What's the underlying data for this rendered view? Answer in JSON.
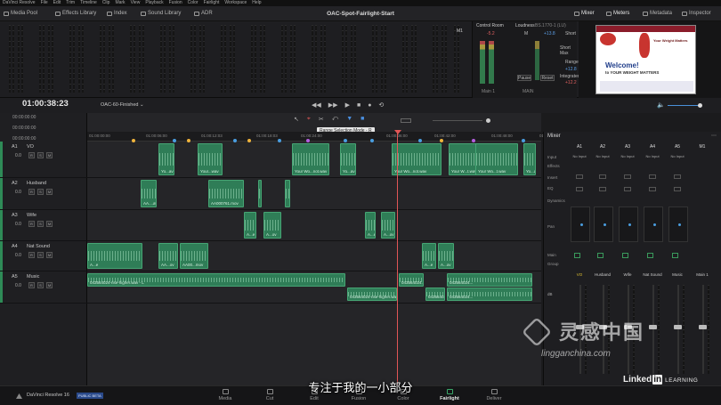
{
  "menubar": [
    "DaVinci Resolve",
    "File",
    "Edit",
    "Trim",
    "Timeline",
    "Clip",
    "Mark",
    "View",
    "Playback",
    "Fusion",
    "Color",
    "Fairlight",
    "Workspace",
    "Help"
  ],
  "toolbar": {
    "media_pool": "Media Pool",
    "effects_library": "Effects Library",
    "index": "Index",
    "sound_library": "Sound Library",
    "adr": "ADR",
    "project_title": "OAC-Spot-Fairlight-Start",
    "mixer": "Mixer",
    "meters": "Meters",
    "metadata": "Metadata",
    "inspector": "Inspector"
  },
  "control_room": {
    "label": "Control Room",
    "m1": "M1",
    "level": "-5.2",
    "loudness_label": "Loudness",
    "standard": "BS.1770-1 (LU)",
    "m_label": "M",
    "m_value": "+13.8",
    "short_label": "Short",
    "short_max_label": "Short Max",
    "range_label": "Range",
    "range_value": "+12.8",
    "integrated_label": "Integrated",
    "integrated_value": "+12.2",
    "pause": "Pause",
    "reset": "Reset",
    "main": "Main 1",
    "dim": "MAIN"
  },
  "video_preview": {
    "headline": "Welcome!",
    "subline": "to YOUR WEIGHT MATTERS",
    "brand": "Your Weight Matters"
  },
  "transport": {
    "timecode": "01:00:38:23",
    "timeline_name": "OAC-60-Finished"
  },
  "timecodes": [
    "00:00:00:00",
    "00:00:00:00",
    "00:00:00:00"
  ],
  "ruler": [
    "01:00:00:00",
    "01:00:06:00",
    "01:00:12:03",
    "01:00:18:03",
    "01:00:24:00",
    "01:00:36:00",
    "01:00:42:00",
    "01:00:48:00",
    "01:00:54:00"
  ],
  "tooltip": "Range Selection Mode - R",
  "tracks": [
    {
      "id": "A1",
      "name": "VO",
      "volume": "0.0",
      "clips": [
        {
          "label": "Yo...av"
        },
        {
          "label": "Your...wav"
        },
        {
          "label": "Your Wo...not.wav"
        },
        {
          "label": "Yo...av"
        },
        {
          "label": "Your Wo...not.wav"
        },
        {
          "label": "Your W...t.wav"
        },
        {
          "label": "Your Wo...t.wav"
        },
        {
          "label": "Yo...av"
        }
      ]
    },
    {
      "id": "A2",
      "name": "Husband",
      "volume": "0.0",
      "clips": [
        {
          "label": "AA....av"
        },
        {
          "label": "AA000761.mov"
        },
        {
          "label": ""
        },
        {
          "label": ""
        }
      ]
    },
    {
      "id": "A3",
      "name": "Wife",
      "volume": "0.0",
      "clips": [
        {
          "label": "A...e"
        },
        {
          "label": "A...ov"
        },
        {
          "label": "A...e"
        },
        {
          "label": "A...ov"
        }
      ]
    },
    {
      "id": "A4",
      "name": "Nat Sound",
      "volume": "0.0",
      "clips": [
        {
          "label": "A...e"
        },
        {
          "label": "AA...ov"
        },
        {
          "label": "AA00...mov"
        },
        {
          "label": "A...e"
        },
        {
          "label": "A...ov"
        }
      ]
    },
    {
      "id": "A5",
      "name": "Music",
      "volume": "0.0",
      "clips": [
        {
          "label": "043564024-rise-higher.wav - L"
        },
        {
          "label": "043564024-rise-higher.wav - R"
        },
        {
          "label": "043564024..."
        },
        {
          "label": "043564024..."
        },
        {
          "label": "043564024..."
        },
        {
          "label": "043564024..."
        }
      ]
    }
  ],
  "mixer": {
    "title": "Mixer",
    "channels": [
      "A1",
      "A2",
      "A3",
      "A4",
      "A5",
      "M1"
    ],
    "input_values": [
      "No Input",
      "No Input",
      "No Input",
      "No Input",
      "No Input"
    ],
    "row_labels": [
      "Input",
      "Effects",
      "Insert",
      "EQ",
      "Dynamics",
      "Pan",
      "Main",
      "Group"
    ],
    "names": [
      "VO",
      "Husband",
      "Wife",
      "Nat Sound",
      "Music",
      "Main 1"
    ],
    "db_label": "dB",
    "fader_levels": [
      0.55,
      0.55,
      0.55,
      0.55,
      0.55,
      0.55
    ]
  },
  "bottom": {
    "app": "DaVinci Resolve 16",
    "beta": "PUBLIC BETA",
    "pages": [
      "Media",
      "Cut",
      "Edit",
      "Fusion",
      "Color",
      "Fairlight",
      "Deliver"
    ],
    "active_page": "Fairlight",
    "linkedin": "Linked",
    "linkedin_in": "in",
    "learning": "LEARNING"
  },
  "subtitle": "专注于我的一小部分",
  "watermark": {
    "text": "灵感中国",
    "url": "lingganchina.com"
  },
  "colors": {
    "clip": "#2f7d57",
    "accent": "#e05656",
    "active_page": "#e8e8e8"
  }
}
